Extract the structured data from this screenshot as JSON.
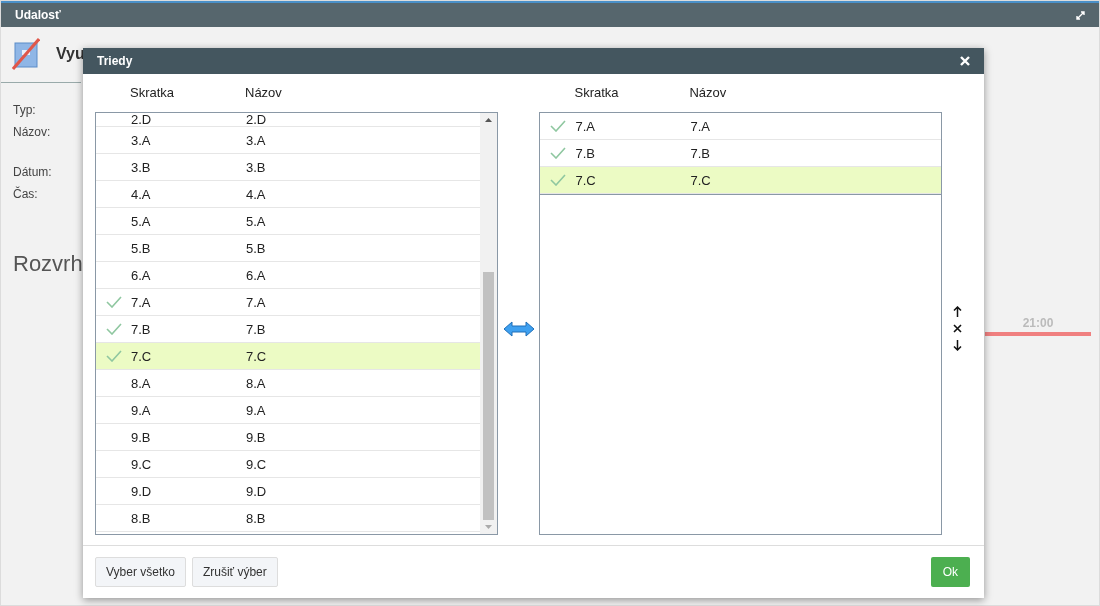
{
  "window": {
    "title": "Udalosť",
    "heading": "Vyu"
  },
  "fields": [
    "Typ:",
    "Názov:",
    "Dátum:",
    "Čas:"
  ],
  "section_title": "Rozvrh",
  "timeline": {
    "time": "21:00"
  },
  "dialog": {
    "title": "Triedy",
    "available": {
      "columns": [
        "Skratka",
        "Názov"
      ],
      "rows": [
        {
          "code": "2.D",
          "name": "2.D",
          "checked": false,
          "selected": false
        },
        {
          "code": "3.A",
          "name": "3.A",
          "checked": false,
          "selected": false
        },
        {
          "code": "3.B",
          "name": "3.B",
          "checked": false,
          "selected": false
        },
        {
          "code": "4.A",
          "name": "4.A",
          "checked": false,
          "selected": false
        },
        {
          "code": "5.A",
          "name": "5.A",
          "checked": false,
          "selected": false
        },
        {
          "code": "5.B",
          "name": "5.B",
          "checked": false,
          "selected": false
        },
        {
          "code": "6.A",
          "name": "6.A",
          "checked": false,
          "selected": false
        },
        {
          "code": "7.A",
          "name": "7.A",
          "checked": true,
          "selected": false
        },
        {
          "code": "7.B",
          "name": "7.B",
          "checked": true,
          "selected": false
        },
        {
          "code": "7.C",
          "name": "7.C",
          "checked": true,
          "selected": true
        },
        {
          "code": "8.A",
          "name": "8.A",
          "checked": false,
          "selected": false
        },
        {
          "code": "9.A",
          "name": "9.A",
          "checked": false,
          "selected": false
        },
        {
          "code": "9.B",
          "name": "9.B",
          "checked": false,
          "selected": false
        },
        {
          "code": "9.C",
          "name": "9.C",
          "checked": false,
          "selected": false
        },
        {
          "code": "9.D",
          "name": "9.D",
          "checked": false,
          "selected": false
        },
        {
          "code": "8.B",
          "name": "8.B",
          "checked": false,
          "selected": false
        }
      ]
    },
    "chosen": {
      "columns": [
        "Skratka",
        "Názov"
      ],
      "rows": [
        {
          "code": "7.A",
          "name": "7.A",
          "checked": true,
          "selected": false
        },
        {
          "code": "7.B",
          "name": "7.B",
          "checked": true,
          "selected": false
        },
        {
          "code": "7.C",
          "name": "7.C",
          "checked": true,
          "selected": true
        }
      ]
    },
    "buttons": [
      "Vyber všetko",
      "Zrušiť výber"
    ],
    "ok": "Ok"
  }
}
